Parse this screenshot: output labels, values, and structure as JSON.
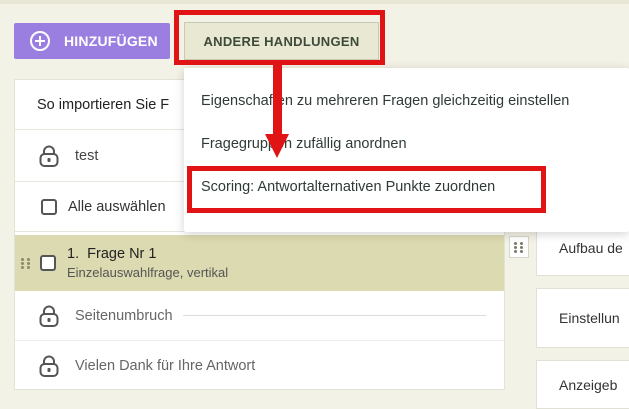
{
  "toolbar": {
    "add_label": "HINZUFÜGEN",
    "other_actions_label": "ANDERE HANDLUNGEN"
  },
  "dropdown_menu": {
    "items": [
      {
        "label": "Eigenschaften zu mehreren Fragen gleichzeitig einstellen"
      },
      {
        "label": "Fragegruppen zufällig anordnen"
      },
      {
        "label": "Scoring: Antwortalternativen Punkte zuordnen"
      }
    ]
  },
  "question_list": {
    "import_hint": "So importieren Sie F",
    "locked_page_label": "test",
    "select_all_label": "Alle auswählen",
    "question": {
      "number": "1.",
      "title": "Frage Nr 1",
      "type": "Einzelauswahlfrage, vertikal"
    },
    "page_break_label": "Seitenumbruch",
    "thanks_label": "Vielen Dank für Ihre Antwort"
  },
  "side_panel": {
    "cards": [
      {
        "label": "Aufbau de"
      },
      {
        "label": "Einstellun"
      },
      {
        "label": "Anzeigeb"
      }
    ]
  },
  "colors": {
    "background": "#f3f2e6",
    "add_button": "#9b7fe0",
    "selected_row": "#dcdab0",
    "annotation_red": "#e01414"
  }
}
